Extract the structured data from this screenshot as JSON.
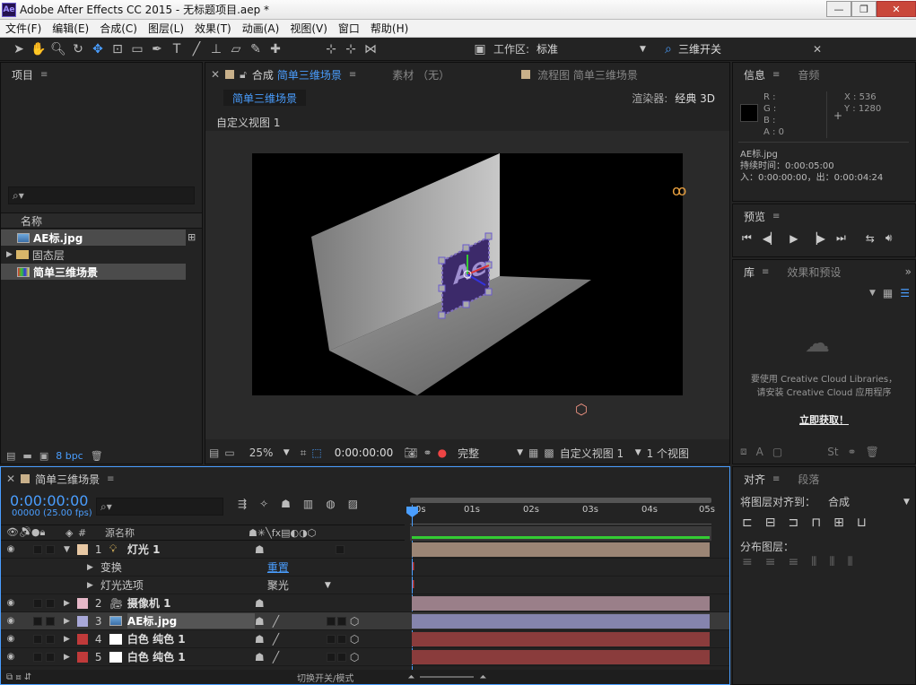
{
  "window": {
    "app_icon": "Ae",
    "title": "Adobe After Effects CC 2015 - 无标题项目.aep *",
    "min": "—",
    "max": "❐",
    "close": "✕"
  },
  "menu": [
    "文件(F)",
    "编辑(E)",
    "合成(C)",
    "图层(L)",
    "效果(T)",
    "动画(A)",
    "视图(V)",
    "窗口",
    "帮助(H)"
  ],
  "toolbar": {
    "workspace_label": "工作区:",
    "workspace_value": "标准",
    "search_value": "三维开关"
  },
  "project": {
    "panel_title": "项目",
    "col_name": "名称",
    "items": [
      {
        "name": "AE标.jpg",
        "type": "image",
        "selected": true
      },
      {
        "name": "固态层",
        "type": "folder",
        "selected": false
      },
      {
        "name": "简单三维场景",
        "type": "comp",
        "selected": true
      }
    ],
    "bpc": "8 bpc"
  },
  "comp_panel": {
    "tab_comp_prefix": "合成",
    "tab_comp_name": "简单三维场景",
    "tab_footage": "素材 （无）",
    "tab_flow": "流程图 简单三维场景",
    "comp_chip": "简单三维场景",
    "renderer_label": "渲染器:",
    "renderer_value": "经典 3D",
    "view_label": "自定义视图 1",
    "zoom": "25%",
    "timecode": "0:00:00:00",
    "quality": "完整",
    "view_select": "自定义视图 1",
    "view_count": "1 个视图"
  },
  "info_panel": {
    "title": "信息",
    "tab_audio": "音频",
    "r": "R :",
    "g": "G :",
    "b": "B :",
    "a": "A : 0",
    "x": "X : 536",
    "y": "Y : 1280",
    "file": "AE标.jpg",
    "duration": "持续时间：0:00:05:00",
    "in_out": "入：0:00:00:00，出：0:00:04:24"
  },
  "preview_panel": {
    "title": "预览"
  },
  "library_panel": {
    "title": "库",
    "tab_effects": "效果和预设",
    "msg1": "要使用 Creative Cloud Libraries，",
    "msg2": "请安装 Creative Cloud 应用程序",
    "link": "立即获取！"
  },
  "align_panel": {
    "title": "对齐",
    "tab_paragraph": "段落",
    "align_to_label": "将图层对齐到：",
    "align_to_value": "合成",
    "distribute_label": "分布图层："
  },
  "timeline": {
    "tab_name": "简单三维场景",
    "timecode": "0:00:00:00",
    "frames": "00000 (25.00 fps)",
    "col_num": "#",
    "col_source": "源名称",
    "ruler": [
      "0s",
      "01s",
      "02s",
      "03s",
      "04s",
      "05s"
    ],
    "footer": "切换开关/模式",
    "layers": [
      {
        "num": "1",
        "name": "灯光 1",
        "kind": "light",
        "label_color": "#e8c8a4",
        "bar_color": "#9b8575",
        "expanded": true
      },
      {
        "num": "2",
        "name": "摄像机 1",
        "kind": "camera",
        "label_color": "#e6b8c8",
        "bar_color": "#9a7f89"
      },
      {
        "num": "3",
        "name": "AE标.jpg",
        "kind": "image",
        "label_color": "#a8a8d8",
        "bar_color": "#8584ad"
      },
      {
        "num": "4",
        "name": "白色 纯色 1",
        "kind": "solid",
        "label_color": "#c03a3a",
        "bar_color": "#8a3c3c"
      },
      {
        "num": "5",
        "name": "白色 纯色 1",
        "kind": "solid",
        "label_color": "#c03a3a",
        "bar_color": "#8a3c3c"
      }
    ],
    "sub_transform": "变换",
    "sub_transform_value": "重置",
    "sub_light_options": "灯光选项",
    "sub_light_value": "聚光"
  },
  "colors": {
    "accent": "#4a9eff",
    "panel_bg": "#232323",
    "dark_bg": "#1b1b1b",
    "selection": "#4b4b4b",
    "link": "#4a9eff"
  }
}
